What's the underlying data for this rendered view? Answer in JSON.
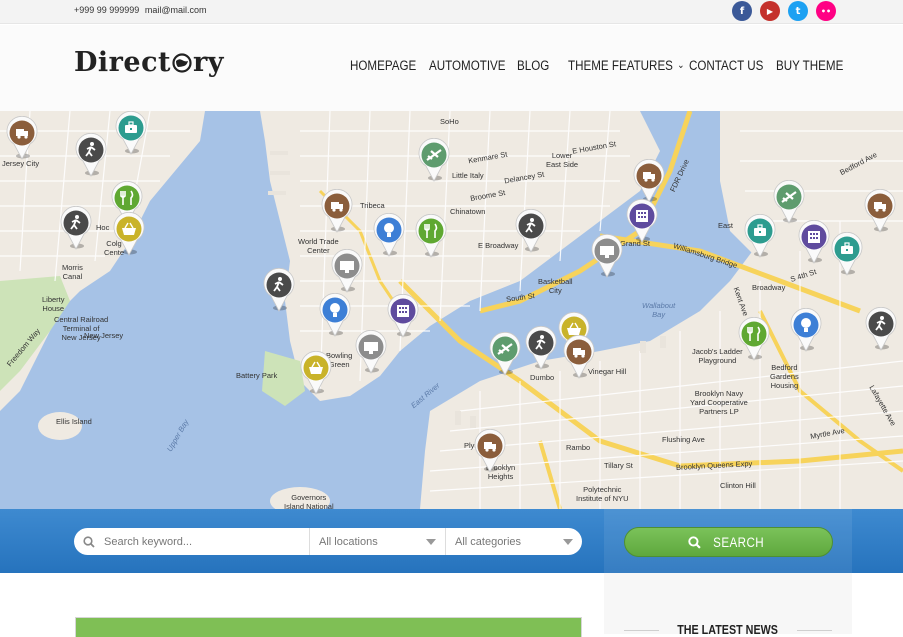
{
  "topbar": {
    "phone": "+999 99 999999",
    "email": "mail@mail.com",
    "social": [
      {
        "icon": "facebook-icon",
        "glyph": "f",
        "color": "#3b5998"
      },
      {
        "icon": "youtube-icon",
        "glyph": "▶",
        "color": "#c4302b"
      },
      {
        "icon": "twitter-icon",
        "glyph": "t",
        "color": "#1da1f2"
      },
      {
        "icon": "flickr-icon",
        "glyph": "••",
        "color": "#ff0084"
      }
    ]
  },
  "header": {
    "logo_left": "Direct",
    "logo_right": "ry",
    "nav": [
      {
        "label": "HOMEPAGE"
      },
      {
        "label": "AUTOMOTIVE"
      },
      {
        "label": "BLOG"
      },
      {
        "label": "THEME FEATURES",
        "dropdown": true
      },
      {
        "label": "CONTACT US"
      },
      {
        "label": "BUY THEME"
      }
    ]
  },
  "map": {
    "labels": [
      {
        "t": "SoHo"
      },
      {
        "t": "Little Italy"
      },
      {
        "t": "Lower\nEast Side"
      },
      {
        "t": "Tribeca"
      },
      {
        "t": "Chinatown"
      },
      {
        "t": "World Trade\nCenter"
      },
      {
        "t": "E Broadway"
      },
      {
        "t": "Grand St"
      },
      {
        "t": "Williamsburg Bridge"
      },
      {
        "t": "FDR Drive"
      },
      {
        "t": "Kenmare St"
      },
      {
        "t": "Delancey St"
      },
      {
        "t": "E Houston St"
      },
      {
        "t": "Broome St"
      },
      {
        "t": "Jersey City"
      },
      {
        "t": "Morris\nCanal"
      },
      {
        "t": "Liberty\nHouse"
      },
      {
        "t": "Central Railroad\nTerminal of\nNew Jersey"
      },
      {
        "t": "Freedom Way"
      },
      {
        "t": "Battery Park"
      },
      {
        "t": "Bowling\nGreen"
      },
      {
        "t": "Ellis Island"
      },
      {
        "t": "Governors\nIsland National"
      },
      {
        "t": "East River"
      },
      {
        "t": "Dumbo"
      },
      {
        "t": "Vinegar Hill"
      },
      {
        "t": "Brooklyn Navy\nYard Cooperative\nPartners LP"
      },
      {
        "t": "Jacob's Ladder\nPlayground"
      },
      {
        "t": "Bedford\nGardens\nHousing"
      },
      {
        "t": "Wallabout\nBay"
      },
      {
        "t": "Flushing Ave"
      },
      {
        "t": "Brooklyn Queens Expy"
      },
      {
        "t": "Clinton Hill"
      },
      {
        "t": "Rambo"
      },
      {
        "t": "Brooklyn\nHeights"
      },
      {
        "t": "Polytechnic\nInstitute of NYU"
      },
      {
        "t": "Tillary St"
      },
      {
        "t": "Plymouth"
      },
      {
        "t": "Basketball\nCity"
      },
      {
        "t": "South St"
      },
      {
        "t": "Broadway"
      },
      {
        "t": "S 4th St"
      },
      {
        "t": "Bedford Ave"
      },
      {
        "t": "Kent Ave"
      },
      {
        "t": "East"
      },
      {
        "t": "Myrtle Ave"
      },
      {
        "t": "Lafayette Ave"
      },
      {
        "t": "Hoc"
      },
      {
        "t": "Colg\nCente"
      },
      {
        "t": "New Jersey"
      },
      {
        "t": "Upper Bay"
      }
    ]
  },
  "search": {
    "keyword_placeholder": "Search keyword...",
    "location_value": "All locations",
    "category_value": "All categories",
    "button_label": "SEARCH"
  },
  "sidebar": {
    "latest_news_title": "THE LATEST NEWS"
  },
  "colors": {
    "brown": "#8b5e3c",
    "teal": "#2d9c8f",
    "darkgray": "#4a4a4a",
    "green": "#5fa832",
    "yellow": "#c9b32a",
    "blue": "#3d7fd6",
    "purple": "#5f4b9e",
    "gray": "#8d8d8d",
    "sage": "#5e9c6e",
    "accent_green": "#6bb84a",
    "band_blue": "#2f7cc7"
  }
}
